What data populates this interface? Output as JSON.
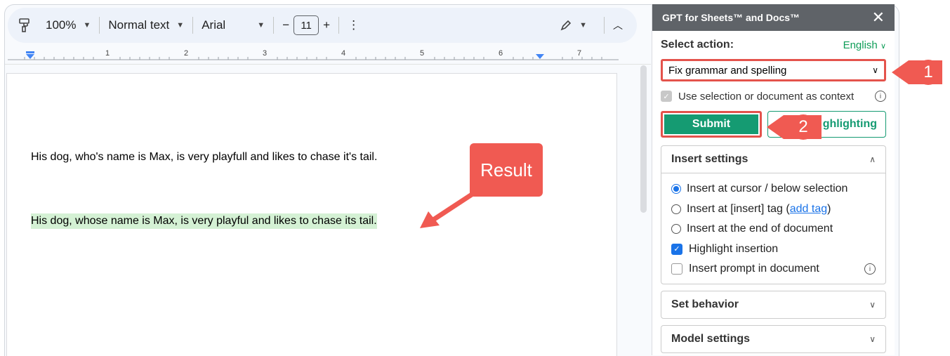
{
  "toolbar": {
    "zoom": "100%",
    "style": "Normal text",
    "font": "Arial",
    "minus": "−",
    "size": "11",
    "plus": "+",
    "more": "⋮"
  },
  "ruler": {
    "marks": [
      "1",
      "2",
      "3",
      "4",
      "5",
      "6",
      "7"
    ]
  },
  "document": {
    "line1": "His dog, who's name is Max, is very playfull and likes to chase it's tail.",
    "line2": "His dog, whose name is Max, is very playful and likes to chase its tail.",
    "result_callout": "Result"
  },
  "sidebar": {
    "title": "GPT for Sheets™ and Docs™",
    "close": "✕",
    "select_action_label": "Select action:",
    "language": "English",
    "selected_action": "Fix grammar and spelling",
    "context_label": "Use selection or document as context",
    "submit_label": "Submit",
    "highlight_label": "ghlighting",
    "insert_settings": {
      "title": "Insert settings",
      "opt1": "Insert at cursor / below selection",
      "opt2_prefix": "Insert at [insert] tag (",
      "opt2_link": "add tag",
      "opt2_suffix": ")",
      "opt3": "Insert at the end of document",
      "opt4": "Highlight insertion",
      "opt5": "Insert prompt in document"
    },
    "set_behavior": "Set behavior",
    "model_settings": "Model settings"
  },
  "badges": {
    "one": "1",
    "two": "2"
  },
  "colors": {
    "accent": "#159b72",
    "callout": "#f05a52",
    "highlight": "#d4f1d4",
    "link": "#1a73e8"
  }
}
